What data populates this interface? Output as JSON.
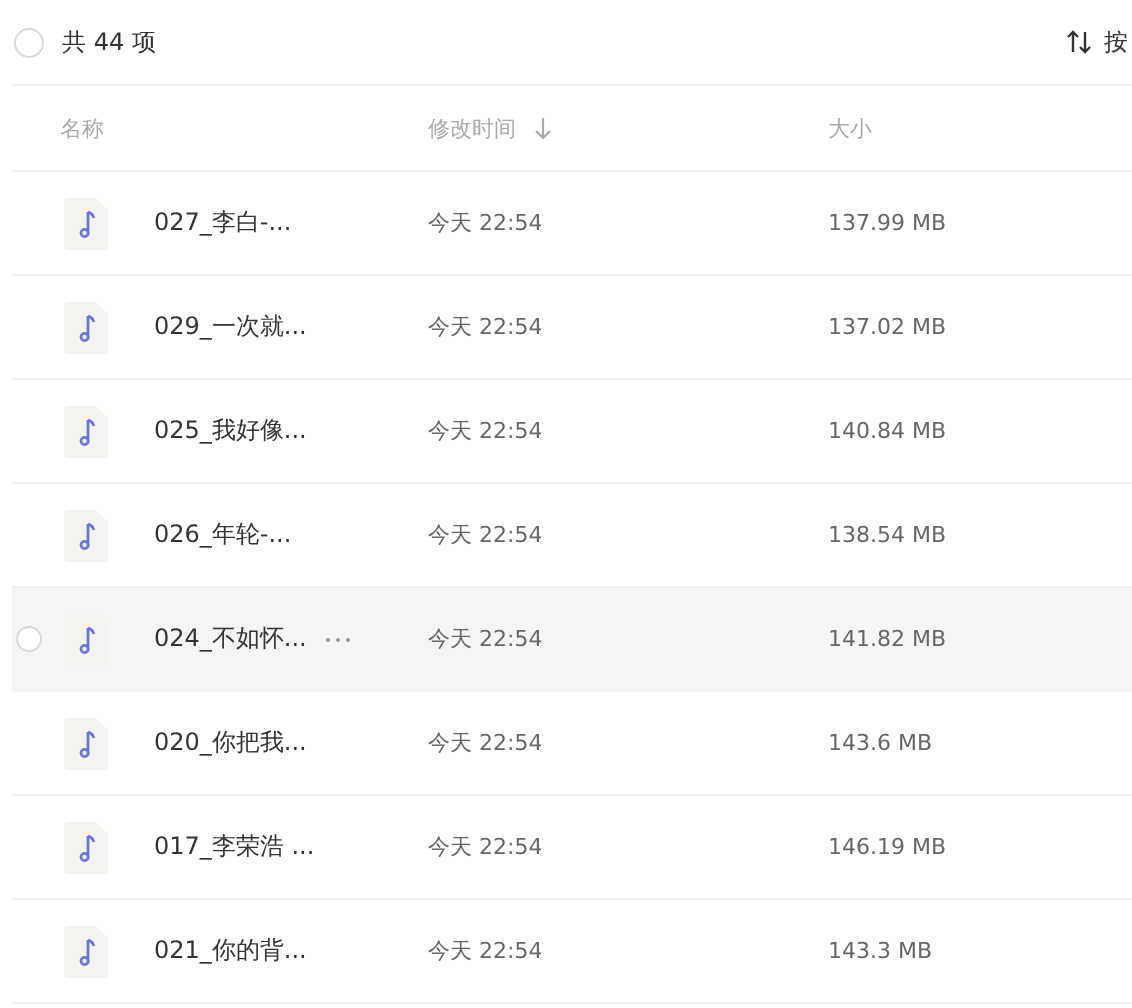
{
  "toolbar": {
    "all_selected": false,
    "count_label": "共 44 项",
    "sort_label": "按"
  },
  "columns": [
    {
      "label": "名称",
      "sorted": false
    },
    {
      "label": "修改时间",
      "sorted": true
    },
    {
      "label": "大小",
      "sorted": false
    }
  ],
  "rows": [
    {
      "name": "027_李白-...",
      "modified": "今天 22:54",
      "size": "137.99 MB",
      "hovered": false
    },
    {
      "name": "029_一次就...",
      "modified": "今天 22:54",
      "size": "137.02 MB",
      "hovered": false
    },
    {
      "name": "025_我好像...",
      "modified": "今天 22:54",
      "size": "140.84 MB",
      "hovered": false
    },
    {
      "name": "026_年轮-...",
      "modified": "今天 22:54",
      "size": "138.54 MB",
      "hovered": false
    },
    {
      "name": "024_不如怀...",
      "modified": "今天 22:54",
      "size": "141.82 MB",
      "hovered": true
    },
    {
      "name": "020_你把我...",
      "modified": "今天 22:54",
      "size": "143.6 MB",
      "hovered": false
    },
    {
      "name": "017_李荣浩 ...",
      "modified": "今天 22:54",
      "size": "146.19 MB",
      "hovered": false
    },
    {
      "name": "021_你的背...",
      "modified": "今天 22:54",
      "size": "143.3 MB",
      "hovered": false
    }
  ]
}
